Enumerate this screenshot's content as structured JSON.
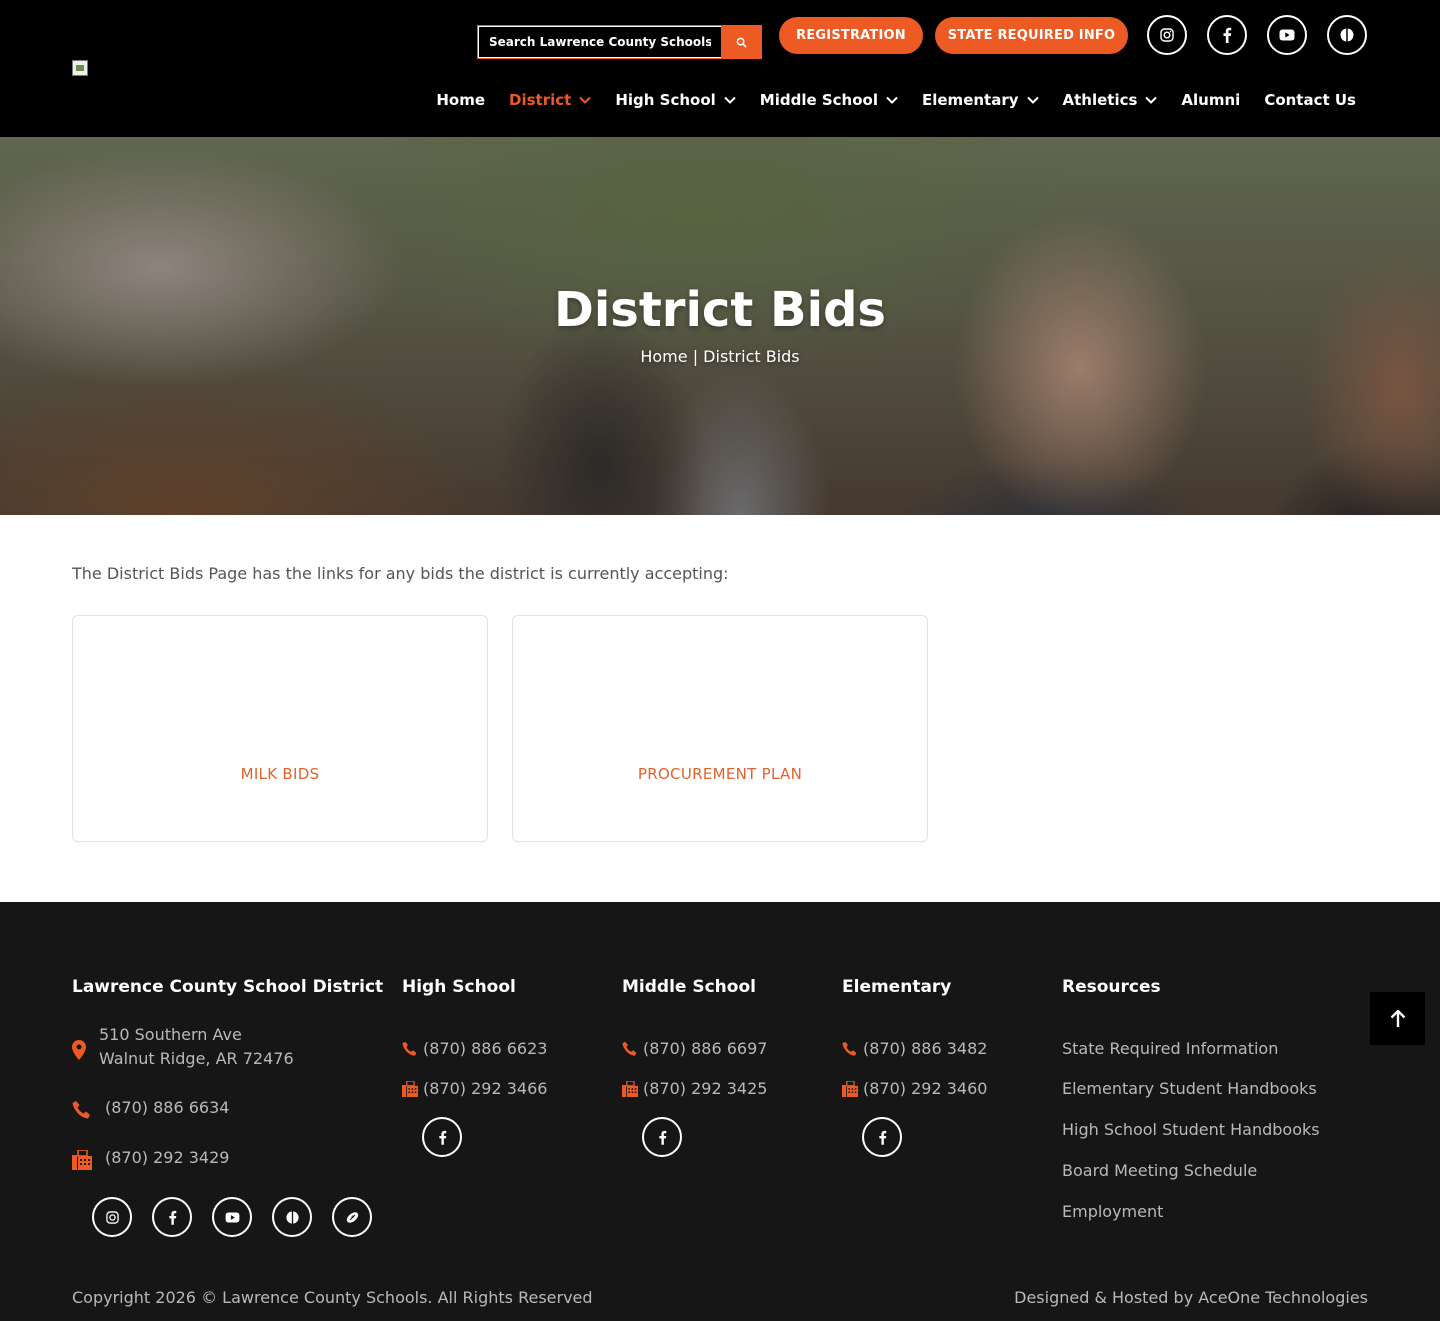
{
  "header": {
    "logo_alt": "",
    "search": {
      "placeholder": "Search Lawrence County Schools",
      "value": ""
    },
    "buttons": {
      "registration": "REGISTRATION",
      "state_required": "STATE REQUIRED INFO"
    },
    "social_icons": [
      "instagram-icon",
      "facebook-icon",
      "youtube-icon",
      "sports-app-icon"
    ]
  },
  "nav": {
    "items": [
      {
        "label": "Home",
        "dropdown": false,
        "active": false
      },
      {
        "label": "District",
        "dropdown": true,
        "active": true
      },
      {
        "label": "High School",
        "dropdown": true,
        "active": false
      },
      {
        "label": "Middle School",
        "dropdown": true,
        "active": false
      },
      {
        "label": "Elementary",
        "dropdown": true,
        "active": false
      },
      {
        "label": "Athletics",
        "dropdown": true,
        "active": false
      },
      {
        "label": "Alumni",
        "dropdown": false,
        "active": false
      },
      {
        "label": "Contact Us",
        "dropdown": false,
        "active": false
      }
    ]
  },
  "hero": {
    "title": "District Bids",
    "breadcrumb": {
      "home": "Home",
      "separator": " | ",
      "current": "District Bids"
    }
  },
  "main": {
    "intro": "The District Bids Page has the links for any bids the district is currently accepting:",
    "cards": [
      {
        "label": "MILK BIDS"
      },
      {
        "label": "PROCUREMENT PLAN"
      }
    ]
  },
  "footer": {
    "district": {
      "title": "Lawrence County School District",
      "address_line1": "510 Southern Ave",
      "address_line2": "Walnut Ridge, AR 72476",
      "phone": "(870) 886 6634",
      "fax": "(870) 292 3429"
    },
    "high_school": {
      "title": "High School",
      "phone": "(870) 886 6623",
      "fax": "(870) 292 3466"
    },
    "middle_school": {
      "title": "Middle School",
      "phone": "(870) 886 6697",
      "fax": "(870) 292 3425"
    },
    "elementary": {
      "title": "Elementary",
      "phone": "(870) 886 3482",
      "fax": "(870) 292 3460"
    },
    "resources": {
      "title": "Resources",
      "links": [
        "State Required Information",
        "Elementary Student Handbooks",
        "High School Student Handbooks",
        "Board Meeting Schedule",
        "Employment"
      ]
    },
    "copyright": "Copyright 2026 © Lawrence County Schools. All Rights Reserved",
    "designed_by": "Designed & Hosted by AceOne Technologies"
  },
  "colors": {
    "accent": "#ee5a24",
    "link": "#e0632e",
    "footer_bg": "#161616",
    "header_bg": "#000000"
  }
}
